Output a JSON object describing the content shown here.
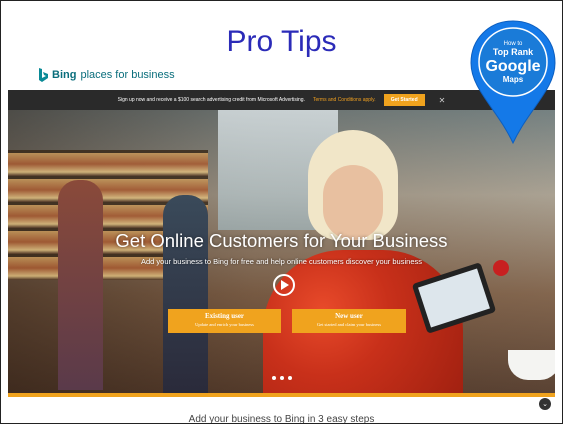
{
  "slide": {
    "title": "Pro Tips"
  },
  "bing": {
    "brand": "Bing",
    "product": " places for business"
  },
  "promo": {
    "text": "Sign up now and receive a $100 search advertising credit from Microsoft Advertising.",
    "terms_link": "Terms and Conditions apply.",
    "cta": "Get Started",
    "close": "✕"
  },
  "hero": {
    "heading": "Get Online Customers for Your Business",
    "subheading": "Add your business to Bing for free and help online customers discover your business",
    "existing": {
      "title": "Existing user",
      "subtitle": "Update and enrich your business"
    },
    "new_user": {
      "title": "New user",
      "subtitle": "Get started and claim your business"
    },
    "carousel_dots": 3
  },
  "footer": {
    "text": "Add your business to Bing in 3 easy steps"
  },
  "badge": {
    "line1": "How to",
    "line2": "Top Rank",
    "line3": "Google",
    "line4": "Maps"
  },
  "colors": {
    "accent": "#f0a31e",
    "title_blue": "#2b2bb8",
    "bing_teal": "#0a6e7c",
    "pin_blue": "#1479e8"
  }
}
